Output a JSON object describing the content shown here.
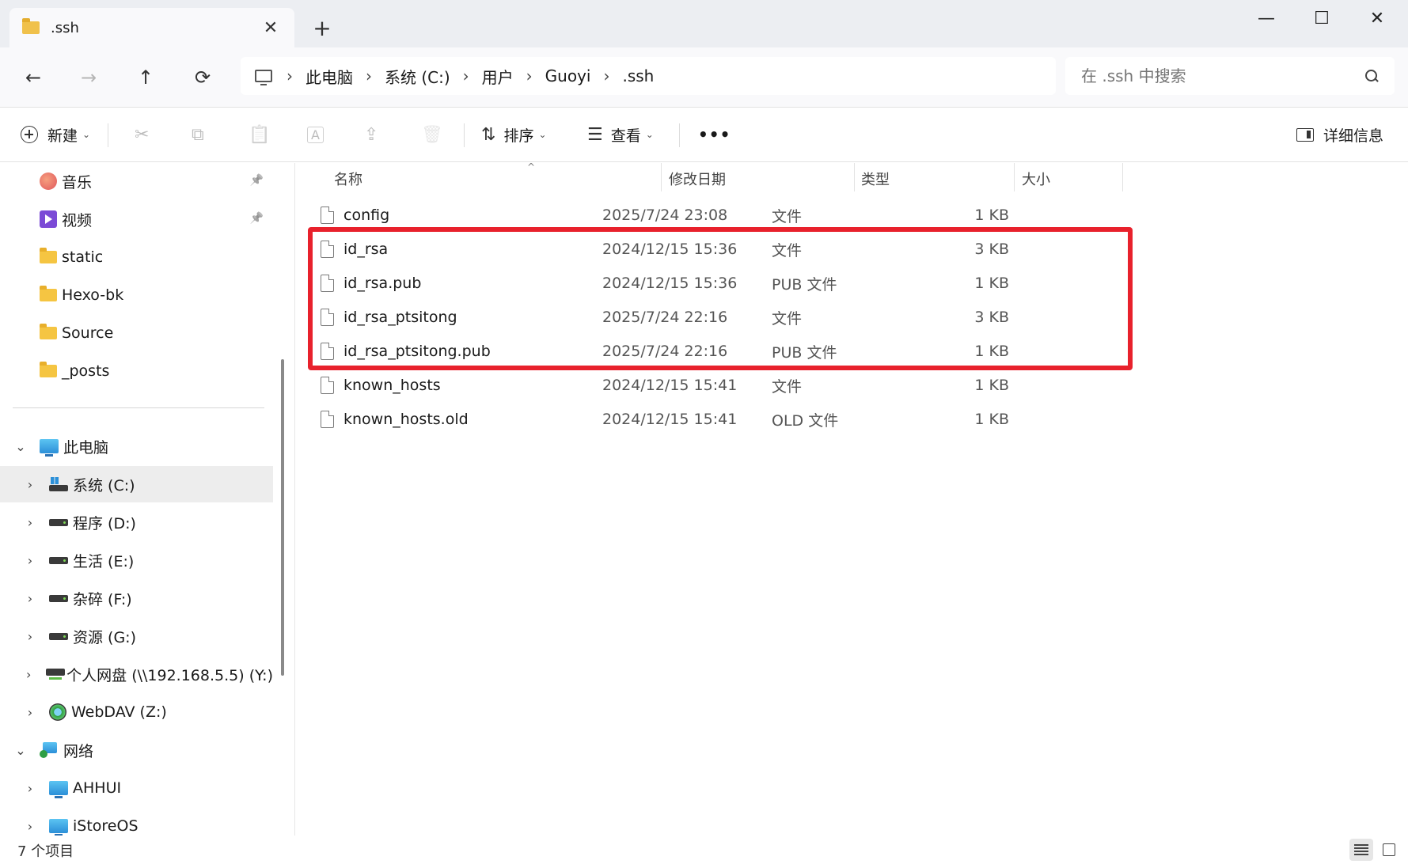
{
  "window": {
    "tab_title": ".ssh",
    "tab_close": "✕",
    "new_tab": "+",
    "minimize": "—",
    "maximize": "☐",
    "close": "✕"
  },
  "nav": {
    "back": "←",
    "forward": "→",
    "up": "↑",
    "refresh": "⟳",
    "breadcrumb": [
      "此电脑",
      "系统 (C:)",
      "用户",
      "Guoyi",
      ".ssh"
    ],
    "separator": "›",
    "search_placeholder": "在 .ssh 中搜索"
  },
  "toolbar": {
    "new_label": "新建",
    "cut": "✂",
    "copy": "⧉",
    "paste": "📋",
    "rename": "A",
    "share": "⇪",
    "delete": "🗑",
    "sort_icon": "⇅",
    "sort_label": "排序",
    "view_icon": "☰",
    "view_label": "查看",
    "more": "•••",
    "details_label": "详细信息",
    "caret": "⌄"
  },
  "sidebar": {
    "quick": [
      {
        "label": "音乐",
        "icon": "music-icon",
        "pinned": true
      },
      {
        "label": "视频",
        "icon": "video-icon",
        "pinned": true
      },
      {
        "label": "static",
        "icon": "folder-icon"
      },
      {
        "label": "Hexo-bk",
        "icon": "folder-icon"
      },
      {
        "label": "Source",
        "icon": "folder-icon"
      },
      {
        "label": "_posts",
        "icon": "folder-icon"
      }
    ],
    "pin_glyph": "📌",
    "this_pc": "此电脑",
    "drives": [
      {
        "label": "系统 (C:)",
        "icon": "system-drive-icon"
      },
      {
        "label": "程序 (D:)",
        "icon": "drive-icon"
      },
      {
        "label": "生活 (E:)",
        "icon": "drive-icon"
      },
      {
        "label": "杂碎 (F:)",
        "icon": "drive-icon"
      },
      {
        "label": "资源 (G:)",
        "icon": "drive-icon"
      },
      {
        "label": "个人网盘 (\\\\192.168.5.5) (Y:)",
        "icon": "network-drive-icon"
      },
      {
        "label": "WebDAV (Z:)",
        "icon": "globe-icon"
      }
    ],
    "network": "网络",
    "network_items": [
      {
        "label": "AHHUI",
        "icon": "computer-icon"
      },
      {
        "label": "iStoreOS",
        "icon": "computer-icon"
      }
    ],
    "chev_open": "⌄",
    "chev_closed": "›"
  },
  "columns": {
    "name": "名称",
    "date": "修改日期",
    "type": "类型",
    "size": "大小",
    "sort_indicator": "^"
  },
  "files": [
    {
      "name": "config",
      "date": "2025/7/24 23:08",
      "type": "文件",
      "size": "1 KB"
    },
    {
      "name": "id_rsa",
      "date": "2024/12/15 15:36",
      "type": "文件",
      "size": "3 KB"
    },
    {
      "name": "id_rsa.pub",
      "date": "2024/12/15 15:36",
      "type": "PUB 文件",
      "size": "1 KB"
    },
    {
      "name": "id_rsa_ptsitong",
      "date": "2025/7/24 22:16",
      "type": "文件",
      "size": "3 KB"
    },
    {
      "name": "id_rsa_ptsitong.pub",
      "date": "2025/7/24 22:16",
      "type": "PUB 文件",
      "size": "1 KB"
    },
    {
      "name": "known_hosts",
      "date": "2024/12/15 15:41",
      "type": "文件",
      "size": "1 KB"
    },
    {
      "name": "known_hosts.old",
      "date": "2024/12/15 15:41",
      "type": "OLD 文件",
      "size": "1 KB"
    }
  ],
  "highlight": {
    "color": "#e8212c"
  },
  "status": {
    "count": "7 个项目"
  }
}
